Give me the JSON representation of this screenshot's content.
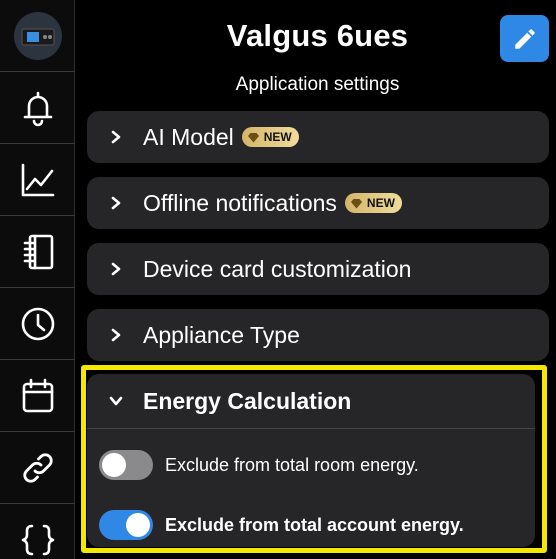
{
  "header": {
    "title": "Valgus 6ues",
    "subtitle": "Application settings"
  },
  "sidebar": {
    "items": [
      {
        "icon": "device-thumbnail-icon"
      },
      {
        "icon": "bell-icon"
      },
      {
        "icon": "line-chart-icon"
      },
      {
        "icon": "notebook-icon"
      },
      {
        "icon": "clock-icon"
      },
      {
        "icon": "calendar-icon"
      },
      {
        "icon": "link-icon"
      },
      {
        "icon": "code-braces-icon"
      }
    ]
  },
  "sections": [
    {
      "label": "AI Model",
      "badge": "NEW"
    },
    {
      "label": "Offline notifications",
      "badge": "NEW"
    },
    {
      "label": "Device card customization"
    },
    {
      "label": "Appliance Type"
    }
  ],
  "energy": {
    "label": "Energy Calculation",
    "toggles": [
      {
        "label": "Exclude from total room energy.",
        "on": false
      },
      {
        "label": "Exclude from total account energy.",
        "on": true
      }
    ]
  },
  "colors": {
    "accent": "#2f87e6",
    "highlight": "#f4e800",
    "badge": "#e6cc80",
    "row_bg": "#262628"
  }
}
